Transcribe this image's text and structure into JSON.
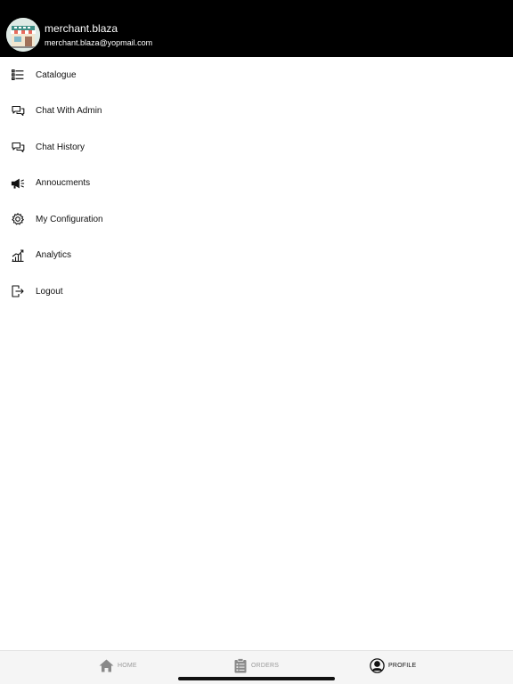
{
  "header": {
    "user_name": "merchant.blaza",
    "user_email": "merchant.blaza@yopmail.com",
    "avatar_icon": "storefront-icon"
  },
  "menu": {
    "items": [
      {
        "label": "Catalogue",
        "icon": "list-icon"
      },
      {
        "label": "Chat With Admin",
        "icon": "chat-bubbles-icon"
      },
      {
        "label": "Chat History",
        "icon": "chat-history-icon"
      },
      {
        "label": "Annoucments",
        "icon": "megaphone-icon"
      },
      {
        "label": "My Configuration",
        "icon": "gear-icon"
      },
      {
        "label": "Analytics",
        "icon": "analytics-chart-icon"
      },
      {
        "label": "Logout",
        "icon": "logout-icon"
      }
    ]
  },
  "tabbar": {
    "tabs": [
      {
        "label": "HOME",
        "icon": "home-icon",
        "active": false
      },
      {
        "label": "ORDERS",
        "icon": "clipboard-icon",
        "active": false
      },
      {
        "label": "PROFILE",
        "icon": "profile-icon",
        "active": true
      }
    ]
  },
  "colors": {
    "header_bg": "#000000",
    "tabbar_bg": "#f5f5f5",
    "active_tab": "#111111",
    "inactive_tab": "#9a9a9a"
  }
}
